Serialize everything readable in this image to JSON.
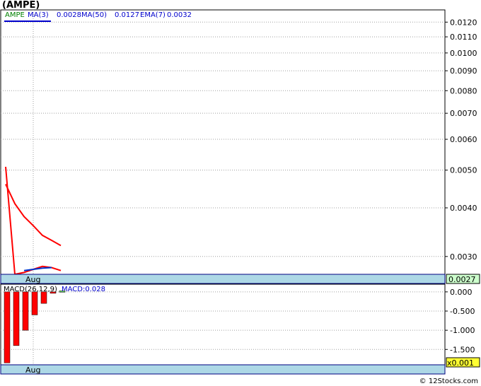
{
  "title": "(AMPE)",
  "credit": "© 12Stocks.com",
  "colors": {
    "price": "#ff0000",
    "ma3": "#0033cc",
    "ma50": "#ff0000",
    "ema7": "#ff0000",
    "grid": "#a0a0a0",
    "band": "#add8e6",
    "band_border": "#000080",
    "last_price_bg": "#ccffcc",
    "scale_bg": "#ffff33",
    "macd_bar": "#ff0000"
  },
  "legend": {
    "symbol": "AMPE",
    "ma3_label": "MA(3)",
    "ma3_value": "0.0028",
    "ma50_label": "MA(50)",
    "ma50_value": "0.0127",
    "ema7_label": "EMA(7)",
    "ema7_value": "0.0032"
  },
  "x_axis_label": "Aug",
  "last_price_label": "0.0027",
  "macd_legend": {
    "label": "MACD(26,12,9)",
    "value_label": "MACD:0.028"
  },
  "macd_scale_label": "x0.001",
  "chart_data": [
    {
      "type": "line",
      "ylim": [
        0.0027,
        0.0129
      ],
      "y_scale": "log",
      "ticks": [
        "0.0120",
        "0.0110",
        "0.0100",
        "0.0090",
        "0.0080",
        "0.0070",
        "0.0060",
        "0.0050",
        "0.0040",
        "0.0030"
      ],
      "tick_values": [
        0.012,
        0.011,
        0.01,
        0.009,
        0.008,
        0.007,
        0.006,
        0.005,
        0.004,
        0.003
      ],
      "x": [
        1,
        2,
        3,
        4,
        5,
        6,
        7
      ],
      "series": [
        {
          "values": [
            0.0051,
            0.0027,
            0.00273,
            0.00278,
            0.00283,
            0.00281,
            0.00276
          ]
        },
        {
          "name": "MA(3)",
          "values": [
            null,
            null,
            0.00276,
            0.00278,
            0.0028,
            0.00281
          ]
        },
        {
          "name": "EMA(7)",
          "values": [
            0.0046,
            0.0041,
            0.0038,
            0.0036,
            0.0034,
            0.0033,
            0.0032
          ]
        }
      ],
      "x_label": "Aug",
      "x_label_at": 4
    },
    {
      "type": "bar",
      "ylim": [
        -1.9,
        0.2
      ],
      "ticks": [
        "0.000",
        "-0.500",
        "-1.000",
        "-1.500"
      ],
      "tick_values": [
        0,
        -0.5,
        -1.0,
        -1.5
      ],
      "x": [
        1,
        2,
        3,
        4,
        5,
        6,
        7
      ],
      "values": [
        -1.85,
        -1.4,
        -1.0,
        -0.6,
        -0.3,
        -0.02,
        0.028
      ]
    }
  ]
}
